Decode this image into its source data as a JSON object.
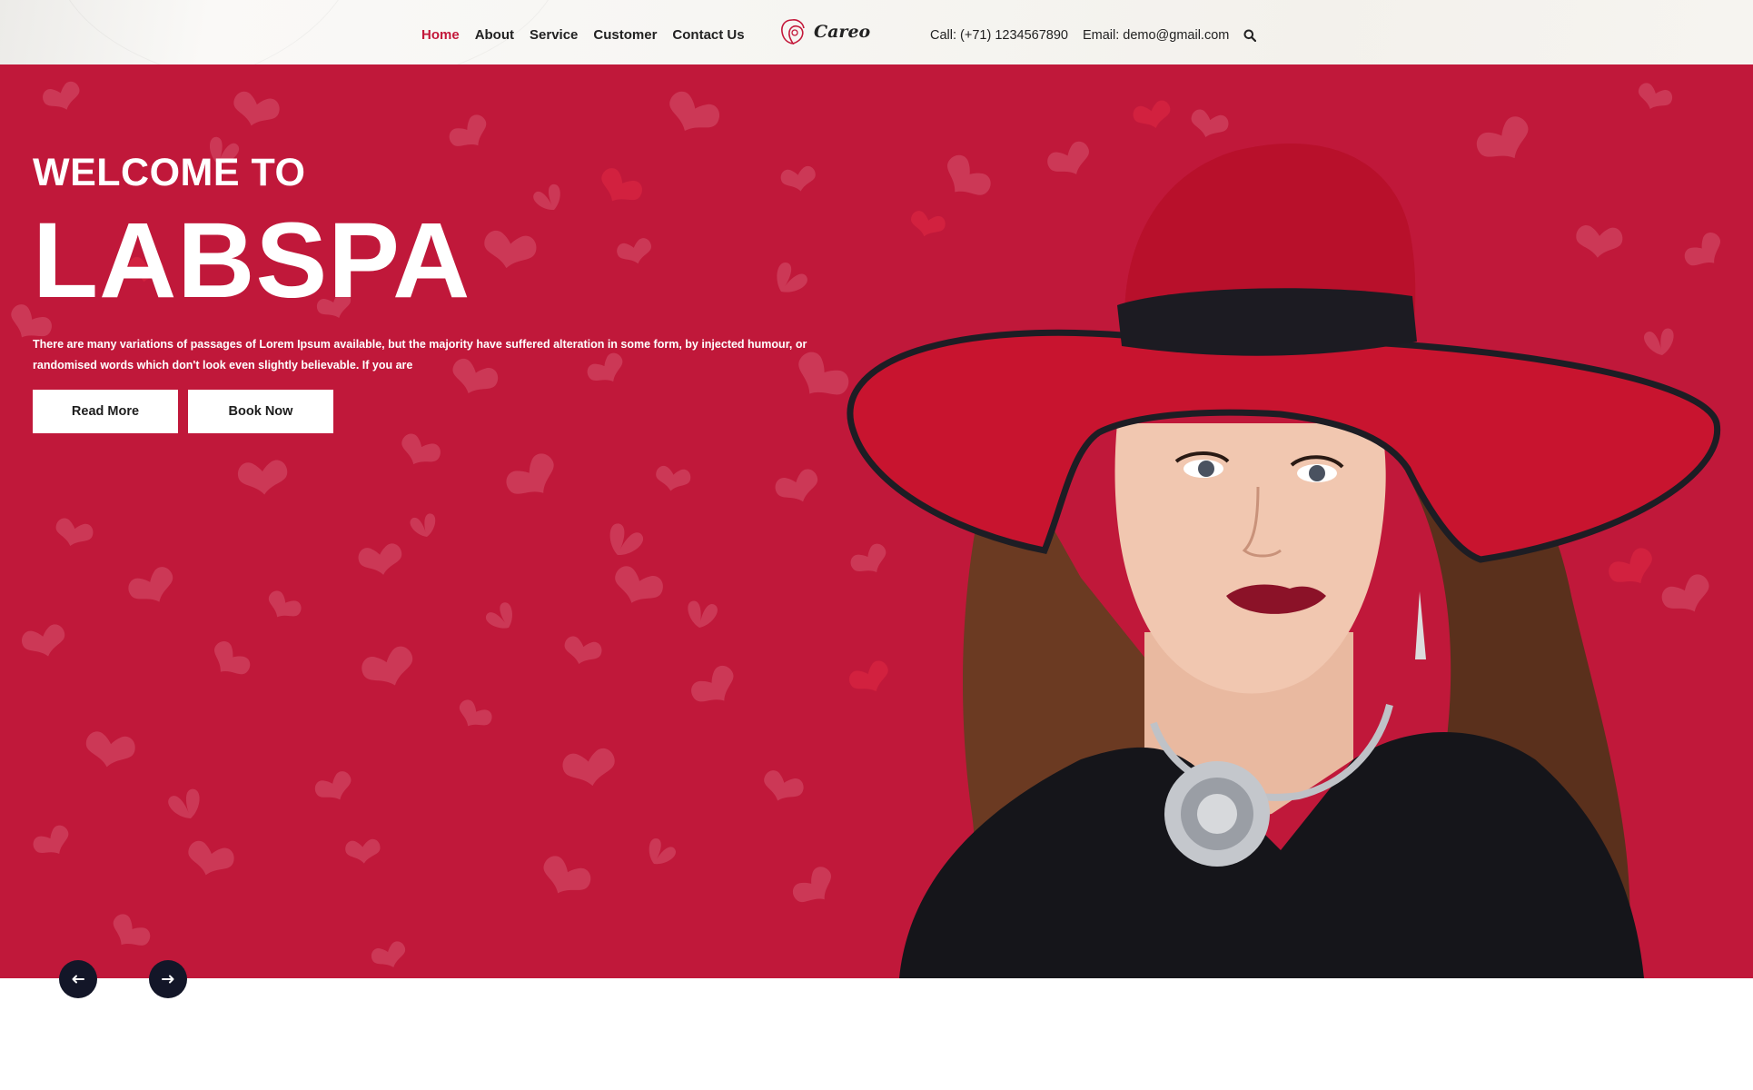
{
  "header": {
    "nav": [
      {
        "label": "Home",
        "active": true
      },
      {
        "label": "About",
        "active": false
      },
      {
        "label": "Service",
        "active": false
      },
      {
        "label": "Customer",
        "active": false
      },
      {
        "label": "Contact Us",
        "active": false
      }
    ],
    "logo_text": "Careo",
    "call": "Call: (+71) 1234567890",
    "email": "Email: demo@gmail.com",
    "search_icon": "search-icon"
  },
  "hero": {
    "welcome": "WELCOME TO",
    "brand": "LABSPA",
    "description": "There are many variations of passages of Lorem Ipsum available, but the majority have suffered alteration in some form, by injected humour, or randomised words which don't look even slightly believable. If you are",
    "read_more": "Read More",
    "book_now": "Book Now",
    "image_desc": "woman-in-red-hat"
  },
  "slider": {
    "prev_icon": "arrow-left-icon",
    "next_icon": "arrow-right-icon"
  },
  "colors": {
    "accent": "#c3183a",
    "hero_bg": "#c0183a",
    "arrow_bg": "#131628"
  }
}
